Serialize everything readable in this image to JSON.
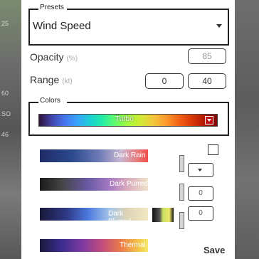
{
  "background": {
    "left_ticks": [
      "25",
      "60",
      "SO",
      "46"
    ]
  },
  "presets": {
    "legend": "Presets",
    "selected": "Wind Speed",
    "caret_icon": "chevron-down-icon"
  },
  "opacity": {
    "label": "Opacity",
    "unit": "(%)",
    "value": "85"
  },
  "range": {
    "label": "Range",
    "unit": "(kt)",
    "min": "0",
    "max": "40"
  },
  "colors": {
    "legend": "Colors",
    "selected_scheme": "Turbo"
  },
  "schemes": [
    {
      "label": "Dark Rain"
    },
    {
      "label": "Dark Purred"
    },
    {
      "label": "Dark Blurred"
    },
    {
      "label": "Thermal"
    }
  ],
  "side_controls": {
    "select_caret_icon": "chevron-down-icon",
    "value_1": "0",
    "value_2": "0"
  },
  "actions": {
    "save_label": "Save"
  },
  "theme": {
    "border_color": "#222222",
    "panel_background": "#ffffff"
  }
}
